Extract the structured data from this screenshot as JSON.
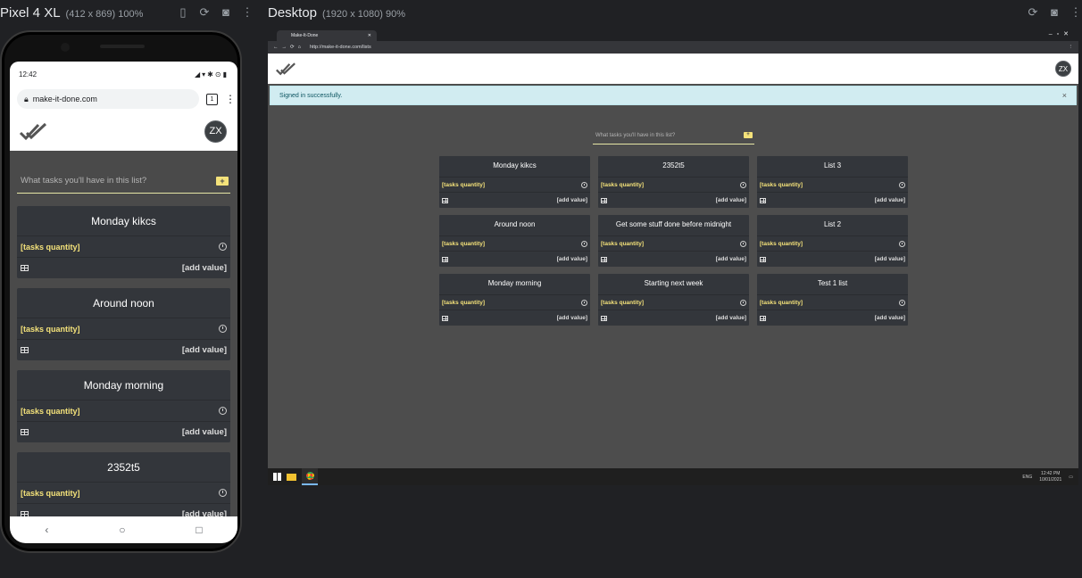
{
  "devtools": {
    "phone_device": "Pixel 4 XL",
    "phone_dims": "(412 x 869) 100%",
    "desktop_device": "Desktop",
    "desktop_dims": "(1920 x 1080) 90%"
  },
  "phone": {
    "status_time": "12:42",
    "status_icons": "◢▾✱⊙▮",
    "url": "make-it-done.com",
    "tab_count": "1",
    "avatar": "ZX",
    "new_list_placeholder": "What tasks you'll have in this list?",
    "lists": [
      {
        "title": "Monday kikcs",
        "qty": "[tasks quantity]",
        "add": "[add value]"
      },
      {
        "title": "Around noon",
        "qty": "[tasks quantity]",
        "add": "[add value]"
      },
      {
        "title": "Monday morning",
        "qty": "[tasks quantity]",
        "add": "[add value]"
      },
      {
        "title": "2352t5",
        "qty": "[tasks quantity]",
        "add": "[add value]"
      }
    ]
  },
  "desktop": {
    "tab_title": "Make-It-Done",
    "url": "http://make-it-done.com/lists",
    "avatar": "ZX",
    "alert": "Signed in successfully.",
    "new_list_placeholder": "What tasks you'll have in this list?",
    "columns": [
      [
        {
          "title": "Monday kikcs",
          "qty": "[tasks quantity]",
          "add": "[add value]"
        },
        {
          "title": "Around noon",
          "qty": "[tasks quantity]",
          "add": "[add value]"
        },
        {
          "title": "Monday morning",
          "qty": "[tasks quantity]",
          "add": "[add value]"
        }
      ],
      [
        {
          "title": "2352t5",
          "qty": "[tasks quantity]",
          "add": "[add value]"
        },
        {
          "title": "Get some stuff done before midnight",
          "qty": "[tasks quantity]",
          "add": "[add value]"
        },
        {
          "title": "Starting next week",
          "qty": "[tasks quantity]",
          "add": "[add value]"
        }
      ],
      [
        {
          "title": "List 3",
          "qty": "[tasks quantity]",
          "add": "[add value]"
        },
        {
          "title": "List 2",
          "qty": "[tasks quantity]",
          "add": "[add value]"
        },
        {
          "title": "Test 1 list",
          "qty": "[tasks quantity]",
          "add": "[add value]"
        }
      ]
    ],
    "taskbar": {
      "lang": "ENG",
      "time": "12:42 PM",
      "date": "10/01/2021"
    }
  },
  "colors": {
    "accent": "#f4e27a",
    "card": "#33363b",
    "app_bg": "#4d4d4d",
    "alert_bg": "#d1ecf1"
  }
}
